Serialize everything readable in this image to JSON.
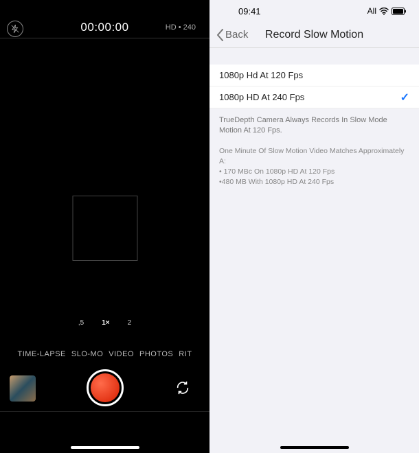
{
  "camera": {
    "timer": "00:00:00",
    "quality_label": "HD • 240",
    "zoom": {
      "wide": ",5",
      "default": "1×",
      "tele": "2"
    },
    "modes": {
      "timelapse": "TIME-LAPSE",
      "slomo": "SLO-MO",
      "video": "VIDEO",
      "photo": "PHOTOS",
      "portrait": "RIT"
    },
    "icons": {
      "flash": "flash-off-icon",
      "switch": "switch-camera-icon"
    }
  },
  "settings": {
    "status": {
      "time": "09:41",
      "carrier": "All"
    },
    "nav": {
      "back": "Back",
      "title": "Record Slow Motion"
    },
    "options": [
      {
        "label": "1080p Hd At 120 Fps",
        "selected": false
      },
      {
        "label": "1080p HD At 240 Fps",
        "selected": true
      }
    ],
    "footer": {
      "line1": "TrueDepth Camera Always Records In Slow Mode Motion At 120 Fps.",
      "line2": "One Minute Of Slow Motion Video Matches Approximately A:",
      "bullet1": "• 170 MBc On 1080p HD At 120 Fps",
      "bullet2": "•480 MB With 1080p HD At 240 Fps"
    }
  }
}
